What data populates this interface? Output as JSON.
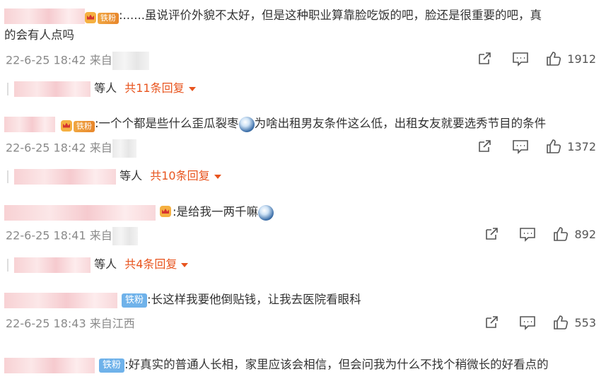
{
  "comments": [
    {
      "text_line1": ":......虽说评价外貌不太好，但是这种职业算靠脸吃饭的吧，脸还是很重要的吧，真",
      "text_line2": "的会有人点吗",
      "badge": "铁粉",
      "time": "22-6-25 18:42",
      "from": "来自",
      "likes": "1912",
      "replies_pre": "等人",
      "replies_more": "共11条回复"
    },
    {
      "text_pre": ":一个个都是些什么歪瓜裂枣",
      "text_post": "为啥出租男友条件这么低，出租女友就要选秀节目的条件",
      "badge": "铁粉",
      "time": "22-6-25 18:42",
      "from": "来自",
      "likes": "1372",
      "replies_pre": "等人",
      "replies_more": "共10条回复"
    },
    {
      "text_pre": ":是给我一两千嘛",
      "time": "22-6-25 18:41",
      "from": "来自",
      "likes": "892",
      "replies_pre": "等人",
      "replies_more": "共4条回复"
    },
    {
      "text_pre": ":长这样我要他倒贴钱，让我去医院看眼科",
      "badge": "铁粉",
      "time": "22-6-25 18:43",
      "from": "来自江西",
      "likes": "553"
    },
    {
      "text_pre": ":好真实的普通人长相，家里应该会相信，但会问我为什么不找个稍微长的好看点的",
      "badge": "铁粉"
    }
  ],
  "icons": {
    "share": "share-icon",
    "comment": "comment-icon",
    "like": "thumb-up-icon",
    "expand": "triangle-down-icon"
  },
  "colors": {
    "accent": "#e8541e",
    "meta": "#8a8a8a",
    "badge_blue": "#6fb2ea",
    "badge_gold": "#f0a742"
  }
}
